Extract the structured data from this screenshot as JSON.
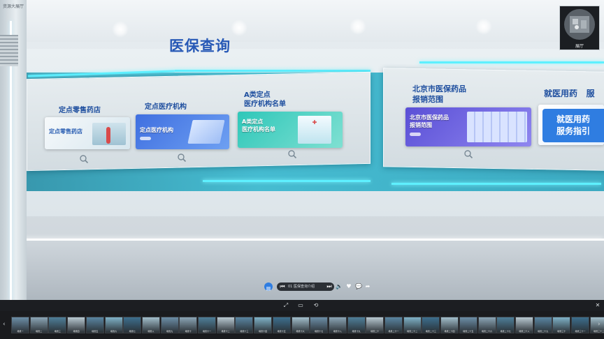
{
  "top_label": "资源大展厅",
  "hall_title": "医保查询",
  "exhibits": [
    {
      "label": "定点零售药店",
      "card_text": "定点零售药店",
      "theme": "pharmacy",
      "accent": "#e8f0f3"
    },
    {
      "label": "定点医疗机构",
      "card_text": "定点医疗机构",
      "theme": "institution",
      "accent": "#3f6fe0"
    },
    {
      "label_line1": "A类定点",
      "label_line2": "医疗机构名单",
      "card_line1": "A类定点",
      "card_line2": "医疗机构名单",
      "theme": "hospital",
      "accent": "#2fc7b9"
    },
    {
      "label_line1": "北京市医保药品",
      "label_line2": "报销范围",
      "card_line1": "北京市医保药品",
      "card_line2": "报销范围",
      "theme": "drugs",
      "accent": "#5a4fd6"
    },
    {
      "label": "就医用药",
      "label_extra": "服",
      "card_line1": "就医用药",
      "card_line2": "服务指引",
      "theme": "guide",
      "accent": "#2f7de1"
    }
  ],
  "minimap": {
    "label": "展厅"
  },
  "audio": {
    "title": "01 医保查询介绍"
  },
  "thumbnails": [
    "场景一",
    "场景二",
    "场景三",
    "场景四",
    "场景五",
    "场景六",
    "场景七",
    "场景八",
    "场景九",
    "场景十",
    "场景十一",
    "场景十二",
    "场景十三",
    "场景十四",
    "场景十五",
    "场景十六",
    "场景十七",
    "场景十八",
    "场景十九",
    "场景二十",
    "场景二十一",
    "场景二十二",
    "场景二十三",
    "场景二十四",
    "场景二十五",
    "场景二十六",
    "场景二十七",
    "场景二十八",
    "场景二十九",
    "场景三十",
    "场景三十一",
    "场景三十二"
  ],
  "thumbnail_colors": [
    "#6c8fa8",
    "#8ca6b6",
    "#4f7f9a",
    "#b9c9d2",
    "#5a86a3",
    "#7fb2c8",
    "#3d6f8e",
    "#a3bfcc"
  ],
  "icons": {
    "zoom": "magnifier-icon",
    "list": "list-icon",
    "prev": "prev-icon",
    "next": "next-icon",
    "volume": "volume-icon",
    "like": "heart-icon",
    "comment": "comment-icon",
    "share": "share-icon",
    "fullscreen": "expand-icon",
    "vr": "vr-icon",
    "gyro": "gyroscope-icon",
    "close": "close-icon",
    "strip_left": "chevron-left-icon",
    "strip_right": "chevron-right-icon"
  }
}
